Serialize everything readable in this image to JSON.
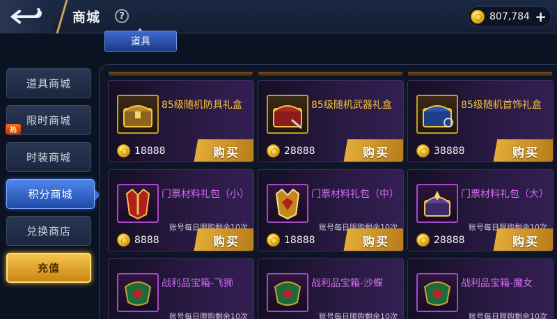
{
  "header": {
    "title": "商城",
    "help_symbol": "?",
    "currency_amount": "807,784",
    "add_symbol": "+"
  },
  "tabs": [
    {
      "label": "道具"
    }
  ],
  "sidebar": {
    "items": [
      {
        "label": "道具商城",
        "active": false
      },
      {
        "label": "限时商城",
        "active": false,
        "badge": "热"
      },
      {
        "label": "时装商城",
        "active": false
      },
      {
        "label": "积分商城",
        "active": true
      },
      {
        "label": "兑换商店",
        "active": false
      },
      {
        "label": "充值",
        "active": false
      }
    ]
  },
  "buy_label": "购买",
  "items": [
    {
      "name": "85级随机防具礼盒",
      "price": "18888",
      "quality": "gold",
      "icon": "golden-chest-icon",
      "limit": ""
    },
    {
      "name": "85级随机武器礼盒",
      "price": "28888",
      "quality": "gold",
      "icon": "red-chest-icon",
      "limit": ""
    },
    {
      "name": "85级随机首饰礼盒",
      "price": "38888",
      "quality": "gold",
      "icon": "blue-chest-icon",
      "limit": ""
    },
    {
      "name": "门票材料礼包（小）",
      "price": "8888",
      "quality": "purple",
      "icon": "red-crest-icon",
      "limit": "账号每日限购剩余10次"
    },
    {
      "name": "门票材料礼包（中）",
      "price": "18888",
      "quality": "purple",
      "icon": "gold-crest-icon",
      "limit": "账号每日限购剩余10次"
    },
    {
      "name": "门票材料礼包（大）",
      "price": "28888",
      "quality": "purple",
      "icon": "ornate-chest-icon",
      "limit": "账号每日限购剩余10次"
    },
    {
      "name": "战利品宝箱-飞狮",
      "price": "",
      "quality": "purple",
      "icon": "green-relic-icon",
      "limit": "账号每日限购剩余10次"
    },
    {
      "name": "战利品宝箱-沙蝶",
      "price": "",
      "quality": "purple",
      "icon": "green-relic-icon",
      "limit": "账号每日限购剩余10次"
    },
    {
      "name": "战利品宝箱-魔女",
      "price": "",
      "quality": "purple",
      "icon": "green-relic-icon",
      "limit": "账号每日限购剩余10次"
    }
  ],
  "colors": {
    "accent_blue": "#3d6bcf",
    "gold": "#f4c23a",
    "purple": "#d46bf2",
    "recharge": "#e3ad39"
  }
}
